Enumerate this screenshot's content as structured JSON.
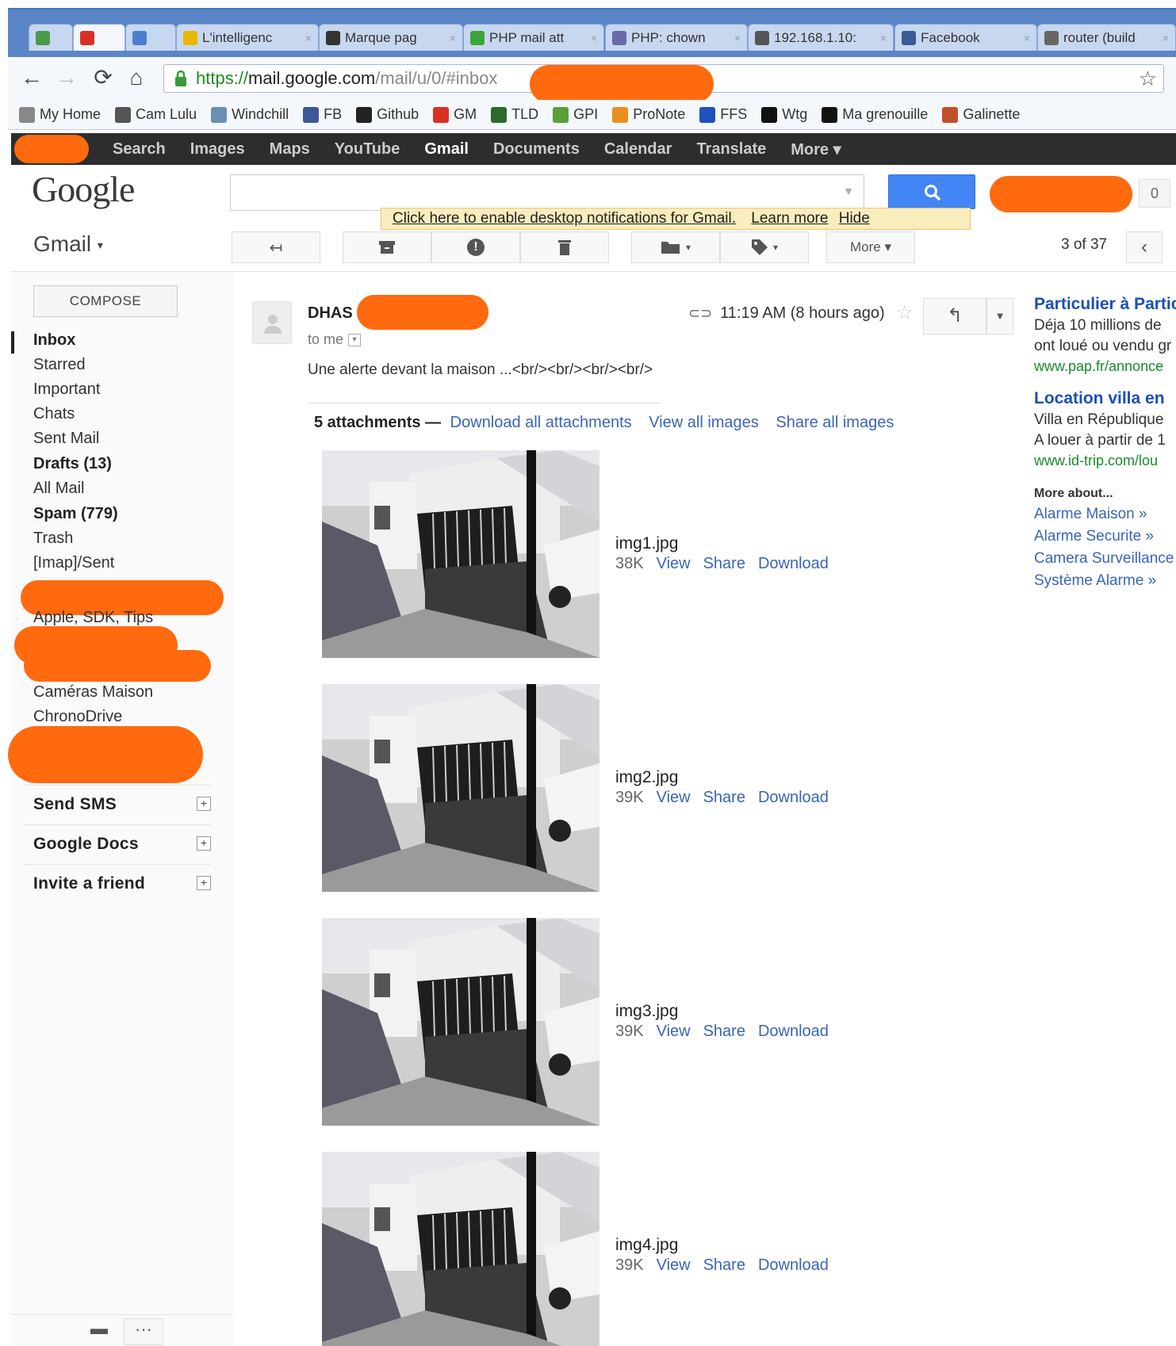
{
  "browser": {
    "tabs": [
      {
        "title": "",
        "favicon": "evernote-icon",
        "color": "#4a9a4a"
      },
      {
        "title": "",
        "favicon": "gmail-icon",
        "color": "#d93025"
      },
      {
        "title": "",
        "favicon": "calendar-icon",
        "color": "#4a7fcf"
      },
      {
        "title": "L'intelligenc",
        "favicon": "warning-icon",
        "color": "#e8b800"
      },
      {
        "title": "Marque pag",
        "favicon": "bookmark-icon",
        "color": "#333333"
      },
      {
        "title": "PHP mail att",
        "favicon": "check-icon",
        "color": "#3aa63a"
      },
      {
        "title": "PHP: chown",
        "favicon": "php-icon",
        "color": "#6a6aa8"
      },
      {
        "title": "192.168.1.10:",
        "favicon": "globe-icon",
        "color": "#555555"
      },
      {
        "title": "Facebook",
        "favicon": "facebook-icon",
        "color": "#3b5998"
      },
      {
        "title": "router (build",
        "favicon": "network-icon",
        "color": "#666666"
      }
    ],
    "url_secure": "https://",
    "url_host": "mail.google.com",
    "url_path": "/mail/u/0/#inbox",
    "bookmarks": [
      {
        "label": "My Home",
        "icon": "network-icon",
        "color": "#888888"
      },
      {
        "label": "Cam Lulu",
        "icon": "globe-icon",
        "color": "#555555"
      },
      {
        "label": "Windchill",
        "icon": "windchill-icon",
        "color": "#6a8fb0"
      },
      {
        "label": "FB",
        "icon": "facebook-icon",
        "color": "#3b5998"
      },
      {
        "label": "Github",
        "icon": "github-icon",
        "color": "#222222"
      },
      {
        "label": "GM",
        "icon": "gmail-icon",
        "color": "#d93025"
      },
      {
        "label": "TLD",
        "icon": "tld-icon",
        "color": "#2a6a2a"
      },
      {
        "label": "GPI",
        "icon": "leaf-icon",
        "color": "#5aa03a"
      },
      {
        "label": "ProNote",
        "icon": "pronote-icon",
        "color": "#e89020"
      },
      {
        "label": "FFS",
        "icon": "ffs-icon",
        "color": "#2050c0"
      },
      {
        "label": "Wtg",
        "icon": "w-icon",
        "color": "#111111"
      },
      {
        "label": "Ma grenouille",
        "icon": "frog-icon",
        "color": "#111111"
      },
      {
        "label": "Galinette",
        "icon": "galinette-icon",
        "color": "#c0502a"
      }
    ]
  },
  "google_bar": {
    "items": [
      "Search",
      "Images",
      "Maps",
      "YouTube",
      "Gmail",
      "Documents",
      "Calendar",
      "Translate",
      "More ▾"
    ]
  },
  "header": {
    "logo": "Google",
    "counter": "0",
    "notification_text": "Click here to enable desktop notifications for Gmail.",
    "learn_more": "Learn more",
    "hide": "Hide",
    "app_label": "Gmail",
    "more_button": "More ▾",
    "pager": "3 of 37"
  },
  "nav": {
    "compose": "COMPOSE",
    "items": [
      {
        "label": "Inbox",
        "bold": true
      },
      {
        "label": "Starred"
      },
      {
        "label": "Important"
      },
      {
        "label": "Chats"
      },
      {
        "label": "Sent Mail"
      },
      {
        "label": "Drafts (13)",
        "bold": true
      },
      {
        "label": "All Mail"
      },
      {
        "label": "Spam (779)",
        "bold": true
      },
      {
        "label": "Trash"
      },
      {
        "label": "[Imap]/Sent"
      }
    ],
    "labels_more": [
      "Apple, SDK, Tips",
      "Caméras Maison",
      "ChronoDrive"
    ],
    "sections": [
      "Send SMS",
      "Google Docs",
      "Invite a friend"
    ]
  },
  "message": {
    "sender": "DHAS",
    "to": "to me",
    "time": "11:19 AM (8 hours ago)",
    "snippet": "Une alerte devant la maison ...<br/><br/><br/><br/>",
    "attachments_count": "5 attachments —",
    "download_all": "Download all attachments",
    "view_all": "View all images",
    "share_all": "Share all images",
    "view": "View",
    "share": "Share",
    "download": "Download",
    "attachments": [
      {
        "name": "img1.jpg",
        "size": "38K"
      },
      {
        "name": "img2.jpg",
        "size": "39K"
      },
      {
        "name": "img3.jpg",
        "size": "39K"
      },
      {
        "name": "img4.jpg",
        "size": "39K"
      }
    ]
  },
  "ads": [
    {
      "title": "Particulier à Particulier",
      "lines": [
        "Déja 10 millions de",
        "ont loué ou vendu gr"
      ],
      "url": "www.pap.fr/annonce"
    },
    {
      "title": "Location villa en",
      "lines": [
        "Villa en République",
        "A louer à partir de 1"
      ],
      "url": "www.id-trip.com/lou"
    }
  ],
  "more_about": "More about...",
  "related": [
    "Alarme Maison »",
    "Alarme Securite »",
    "Camera Surveillance",
    "Système Alarme »"
  ]
}
